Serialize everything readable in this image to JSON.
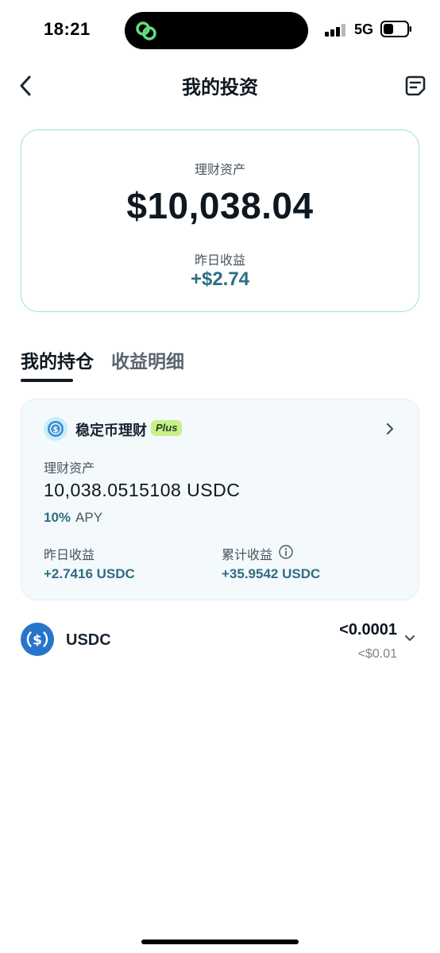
{
  "status_bar": {
    "time": "18:21",
    "network": "5G"
  },
  "header": {
    "title": "我的投资"
  },
  "summary": {
    "asset_label": "理财资产",
    "asset_value": "$10,038.04",
    "yesterday_label": "昨日收益",
    "yesterday_value": "+$2.74"
  },
  "tabs": [
    {
      "label": "我的持仓",
      "active": true
    },
    {
      "label": "收益明细",
      "active": false
    }
  ],
  "product": {
    "name": "稳定币理财",
    "badge": "Plus",
    "asset_label": "理财资产",
    "asset_value": "10,038.0515108  USDC",
    "apy_value": "10%",
    "apy_label": "APY",
    "yesterday_label": "昨日收益",
    "yesterday_value": "+2.7416 USDC",
    "total_label": "累计收益",
    "total_value": "+35.9542 USDC"
  },
  "holding": {
    "name": "USDC",
    "amount": "<0.0001",
    "usd_value": "<$0.01"
  },
  "colors": {
    "accent": "#2d6e83",
    "card_border": "#9adfe3",
    "plus_badge": "#c7f08a",
    "usdc_blue": "#2775ca"
  }
}
